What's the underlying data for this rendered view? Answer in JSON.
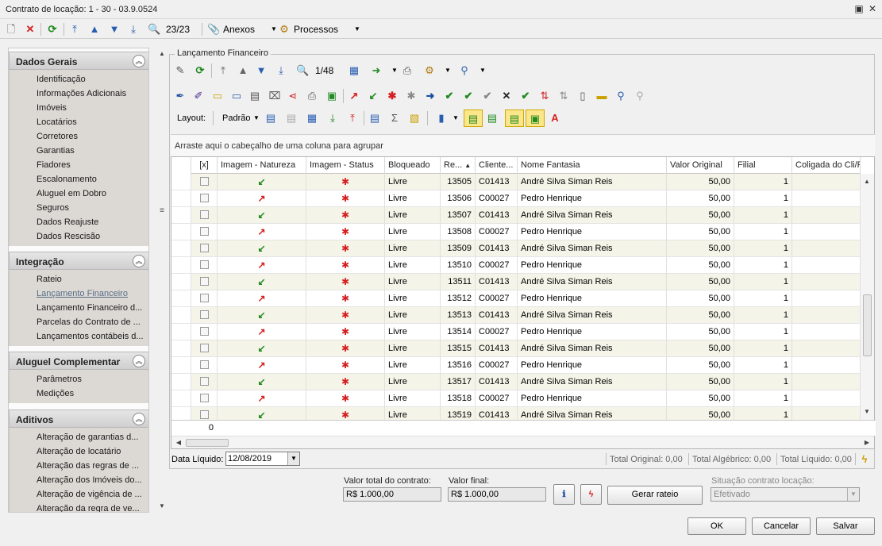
{
  "window": {
    "title": "Contrato de locação: 1 - 30 - 03.9.0524"
  },
  "main_toolbar": {
    "record_counter": "23/23",
    "anexos_label": "Anexos",
    "processos_label": "Processos"
  },
  "sidebar": {
    "sections": [
      {
        "title": "Dados Gerais",
        "items": [
          "Identificação",
          "Informações Adicionais",
          "Imóveis",
          "Locatários",
          "Corretores",
          "Garantias",
          "Fiadores",
          "Escalonamento",
          "Aluguel em Dobro",
          "Seguros",
          "Dados Reajuste",
          "Dados Rescisão"
        ]
      },
      {
        "title": "Integração",
        "items": [
          "Rateio",
          "Lançamento Financeiro",
          "Lançamento Financeiro d...",
          "Parcelas do Contrato de ...",
          "Lançamentos contábeis d..."
        ]
      },
      {
        "title": "Aluguel Complementar",
        "items": [
          "Parâmetros",
          "Medições"
        ]
      },
      {
        "title": "Aditivos",
        "items": [
          "Alteração de garantias d...",
          "Alteração de locatário",
          "Alteração das regras de ...",
          "Alteração dos Imóveis do...",
          "Alteração de vigência de ...",
          "Alteração da regra de ve..."
        ]
      }
    ],
    "active_item": "Lançamento Financeiro"
  },
  "lancamento": {
    "group_title": "Lançamento Financeiro",
    "record_counter": "1/48",
    "layout_label": "Layout:",
    "layout_value": "Padrão",
    "group_hint": "Arraste aqui o cabeçalho de uma coluna para agrupar",
    "columns": [
      "[x]",
      "Imagem - Natureza",
      "Imagem - Status",
      "Bloqueado",
      "Re...",
      "Cliente...",
      "Nome Fantasia",
      "Valor Original",
      "Filial",
      "Coligada do Cli/For"
    ],
    "rows": [
      {
        "natureza": "down",
        "bloqueado": "Livre",
        "ref": "13505",
        "cliente": "C01413",
        "nome": "André Silva Siman Reis",
        "valor": "50,00",
        "filial": "1"
      },
      {
        "natureza": "up",
        "bloqueado": "Livre",
        "ref": "13506",
        "cliente": "C00027",
        "nome": "Pedro Henrique",
        "valor": "50,00",
        "filial": "1"
      },
      {
        "natureza": "down",
        "bloqueado": "Livre",
        "ref": "13507",
        "cliente": "C01413",
        "nome": "André Silva Siman Reis",
        "valor": "50,00",
        "filial": "1"
      },
      {
        "natureza": "up",
        "bloqueado": "Livre",
        "ref": "13508",
        "cliente": "C00027",
        "nome": "Pedro Henrique",
        "valor": "50,00",
        "filial": "1"
      },
      {
        "natureza": "down",
        "bloqueado": "Livre",
        "ref": "13509",
        "cliente": "C01413",
        "nome": "André Silva Siman Reis",
        "valor": "50,00",
        "filial": "1"
      },
      {
        "natureza": "up",
        "bloqueado": "Livre",
        "ref": "13510",
        "cliente": "C00027",
        "nome": "Pedro Henrique",
        "valor": "50,00",
        "filial": "1"
      },
      {
        "natureza": "down",
        "bloqueado": "Livre",
        "ref": "13511",
        "cliente": "C01413",
        "nome": "André Silva Siman Reis",
        "valor": "50,00",
        "filial": "1"
      },
      {
        "natureza": "up",
        "bloqueado": "Livre",
        "ref": "13512",
        "cliente": "C00027",
        "nome": "Pedro Henrique",
        "valor": "50,00",
        "filial": "1"
      },
      {
        "natureza": "down",
        "bloqueado": "Livre",
        "ref": "13513",
        "cliente": "C01413",
        "nome": "André Silva Siman Reis",
        "valor": "50,00",
        "filial": "1"
      },
      {
        "natureza": "up",
        "bloqueado": "Livre",
        "ref": "13514",
        "cliente": "C00027",
        "nome": "Pedro Henrique",
        "valor": "50,00",
        "filial": "1"
      },
      {
        "natureza": "down",
        "bloqueado": "Livre",
        "ref": "13515",
        "cliente": "C01413",
        "nome": "André Silva Siman Reis",
        "valor": "50,00",
        "filial": "1"
      },
      {
        "natureza": "up",
        "bloqueado": "Livre",
        "ref": "13516",
        "cliente": "C00027",
        "nome": "Pedro Henrique",
        "valor": "50,00",
        "filial": "1"
      },
      {
        "natureza": "down",
        "bloqueado": "Livre",
        "ref": "13517",
        "cliente": "C01413",
        "nome": "André Silva Siman Reis",
        "valor": "50,00",
        "filial": "1"
      },
      {
        "natureza": "up",
        "bloqueado": "Livre",
        "ref": "13518",
        "cliente": "C00027",
        "nome": "Pedro Henrique",
        "valor": "50,00",
        "filial": "1"
      },
      {
        "natureza": "down",
        "bloqueado": "Livre",
        "ref": "13519",
        "cliente": "C01413",
        "nome": "André Silva Siman Reis",
        "valor": "50,00",
        "filial": "1"
      }
    ],
    "footer_count": "0",
    "data_liquido_label": "Data Líquido:",
    "data_liquido_value": "12/08/2019",
    "totals": {
      "original": "Total Original: 0,00",
      "algebrico": "Total Algébrico: 0,00",
      "liquido": "Total Líquido: 0,00"
    }
  },
  "bottom": {
    "valor_total_label": "Valor total do contrato:",
    "valor_total_value": "R$ 1.000,00",
    "valor_final_label": "Valor final:",
    "valor_final_value": "R$ 1.000,00",
    "gerar_rateio_label": "Gerar rateio",
    "situacao_label": "Situação contrato locação:",
    "situacao_value": "Efetivado"
  },
  "dialog_buttons": {
    "ok": "OK",
    "cancel": "Cancelar",
    "save": "Salvar"
  },
  "colors": {
    "accent_green": "#1f8a1f",
    "accent_red": "#d42020",
    "highlight_yellow": "#fbe68a",
    "alt_row": "#f5f4e8"
  }
}
